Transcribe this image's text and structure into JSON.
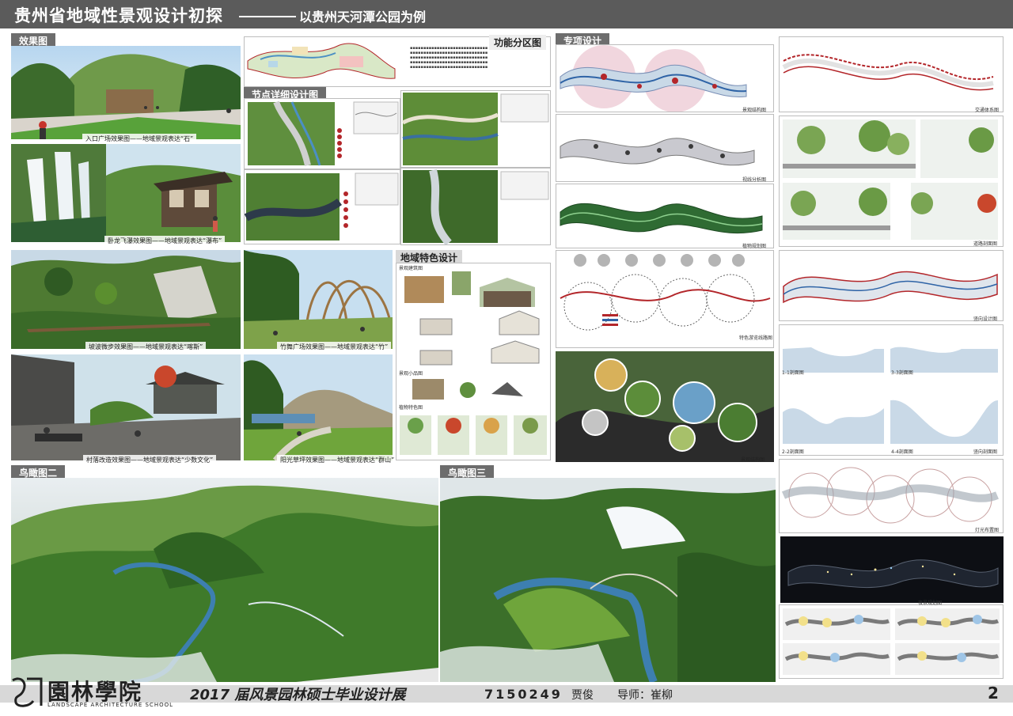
{
  "header": {
    "title": "贵州省地域性景观设计初探",
    "subtitle": "以贵州天河潭公园为例"
  },
  "sections": {
    "effects": "效果图",
    "zoning": "功能分区图",
    "special": "专项设计",
    "node_detail": "节点详细设计图",
    "regional": "地域特色设计",
    "aerial_two": "鸟瞰图二",
    "aerial_three": "鸟瞰图三"
  },
  "effect_captions": [
    "入口广场效果图——地域景观表达“石”",
    "卧龙飞瀑效果图——地域景观表达“瀑布”",
    "竹舞广场效果图——地域景观表达“竹”",
    "坡波微步效果图——地域景观表达“喀斯”",
    "村落改造效果图——地域景观表达“少数文化”",
    "阳光草坪效果图——地域景观表达“群山”"
  ],
  "special_labels": [
    "景观结构图",
    "视线分析图",
    "植物规划图",
    "交通体系图",
    "道路剖面图",
    "竖向设计图",
    "竖向剖面图",
    "灯光布置图",
    "夜景规划图",
    "特色游览线路图",
    "景观结构图"
  ],
  "regional_labels": [
    "景观建筑图",
    "景观小品图",
    "植物特色图"
  ],
  "section_marks": [
    "1-1剖面图",
    "3-3剖面图",
    "2-2剖面图",
    "4-4剖面图"
  ],
  "footer": {
    "logo_cn": "園林學院",
    "logo_en": "LANDSCAPE ARCHITECTURE SCHOOL",
    "exhibition": "2017 届风景园林硕士毕业设计展",
    "student_id": "7150249",
    "student_name": "贾俊",
    "advisor": "导师：崔柳",
    "page": "2"
  },
  "colors": {
    "header_bg": "#5b5b5b",
    "tab_bg": "#6d6d6d",
    "forest": "#3f7a2a",
    "river": "#3d7fb0",
    "plan_red": "#b3262a"
  }
}
